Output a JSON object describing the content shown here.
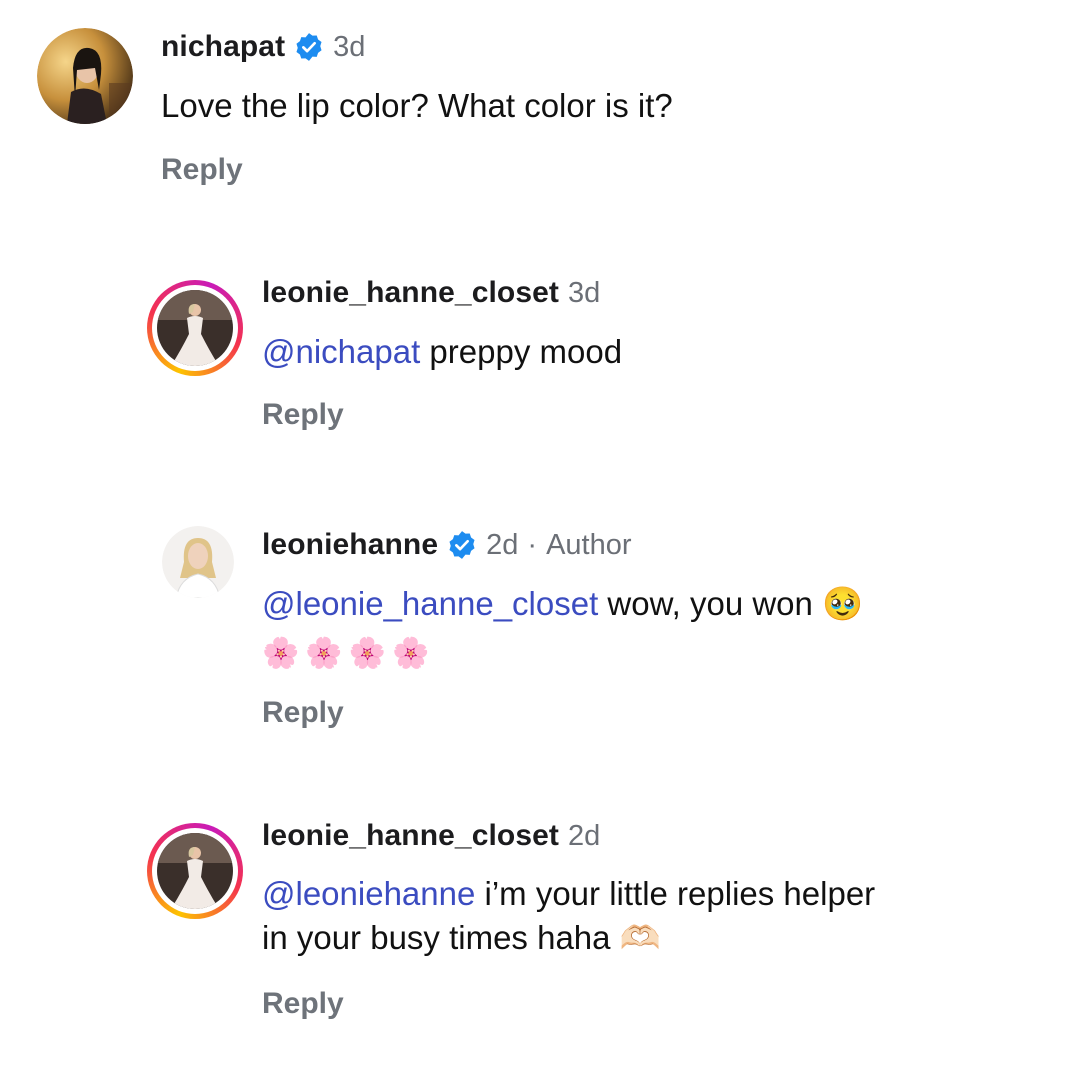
{
  "comments": [
    {
      "username": "nichapat",
      "verified": true,
      "time": "3d",
      "text": "Love the lip color? What color is it?",
      "reply_label": "Reply",
      "avatar_icon": "profile-photo-icon"
    },
    {
      "username": "leonie_hanne_closet",
      "verified": false,
      "time": "3d",
      "mention": "@nichapat",
      "text": " preppy mood",
      "reply_label": "Reply",
      "avatar_icon": "story-ring-profile-photo-icon"
    },
    {
      "username": "leoniehanne",
      "verified": true,
      "time": "2d",
      "separator": "·",
      "role": "Author",
      "mention": "@leonie_hanne_closet",
      "text": " wow, you won 🥹",
      "text_line2": "🌸🌸🌸🌸",
      "reply_label": "Reply",
      "avatar_icon": "profile-photo-icon"
    },
    {
      "username": "leonie_hanne_closet",
      "verified": false,
      "time": "2d",
      "mention": "@leoniehanne",
      "text": " i’m your little replies helper",
      "text_line2": "in your busy times haha 🫶🏻",
      "reply_label": "Reply",
      "avatar_icon": "story-ring-profile-photo-icon"
    }
  ],
  "colors": {
    "mention": "#3b4cc0",
    "verified_blue": "#1d8cf0",
    "meta_gray": "#6b6f76",
    "ring_start": "#fdc300",
    "ring_mid": "#f4324f",
    "ring_end": "#c91bb8"
  }
}
